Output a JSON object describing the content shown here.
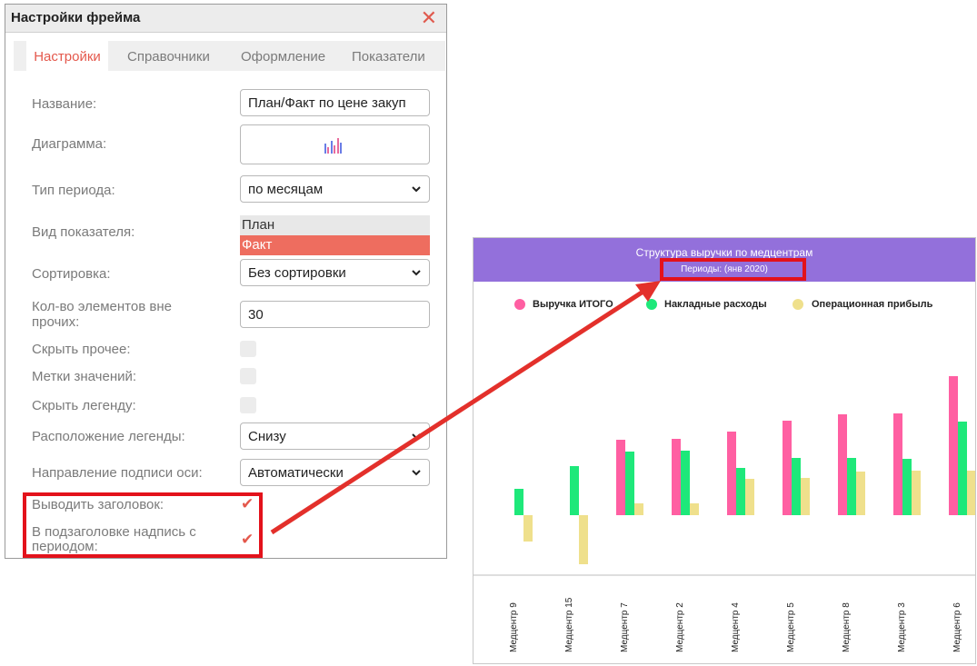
{
  "dialog": {
    "title": "Настройки фрейма",
    "tabs": [
      "Настройки",
      "Справочники",
      "Оформление",
      "Показатели"
    ],
    "fields": {
      "name_label": "Название:",
      "name_value": "План/Факт по цене закуп",
      "chart_label": "Диаграмма:",
      "period_type_label": "Тип периода:",
      "period_type_value": "по месяцам",
      "indicator_label": "Вид показателя:",
      "indicator_options": [
        "План",
        "Факт"
      ],
      "indicator_selected": "Факт",
      "sort_label": "Сортировка:",
      "sort_value": "Без сортировки",
      "count_label_1": "Кол-во элементов вне",
      "count_label_2": "прочих:",
      "count_value": "30",
      "hide_other_label": "Скрыть прочее:",
      "value_labels_label": "Метки значений:",
      "hide_legend_label": "Скрыть легенду:",
      "legend_position_label": "Расположение легенды:",
      "legend_position_value": "Снизу",
      "axis_direction_label": "Направление подписи оси:",
      "axis_direction_value": "Автоматически",
      "show_title_label": "Выводить заголовок:",
      "subtitle_label_1": "В подзаголовке надпись с",
      "subtitle_label_2": "периодом:"
    },
    "checkboxes": {
      "hide_other": false,
      "value_labels": false,
      "hide_legend": false,
      "show_title": true,
      "subtitle_period": true
    }
  },
  "colors": {
    "accent": "#e4584c",
    "highlight": "#e3121b",
    "chart_header": "#9370db",
    "revenue": "#ff5fa2",
    "overhead": "#1ee87a",
    "profit": "#efe08c"
  },
  "chart_data": {
    "type": "bar",
    "title": "Структура выручки по медцентрам",
    "subtitle": "Периоды: (янв 2020)",
    "categories": [
      "Медцентр 9",
      "Медцентр 15",
      "Медцентр 7",
      "Медцентр 2",
      "Медцентр 4",
      "Медцентр 5",
      "Медцентр 8",
      "Медцентр 3",
      "Медцентр 6"
    ],
    "series": [
      {
        "name": "Выручка ИТОГО",
        "values": [
          0,
          0,
          83,
          84,
          92,
          104,
          111,
          112,
          153
        ]
      },
      {
        "name": "Накладные расходы",
        "values": [
          29,
          54,
          70,
          71,
          52,
          63,
          63,
          62,
          103
        ]
      },
      {
        "name": "Операционная прибыль",
        "values": [
          -29,
          -54,
          13,
          13,
          40,
          41,
          48,
          49,
          49
        ]
      }
    ],
    "legend_position": "top",
    "grid": false
  }
}
